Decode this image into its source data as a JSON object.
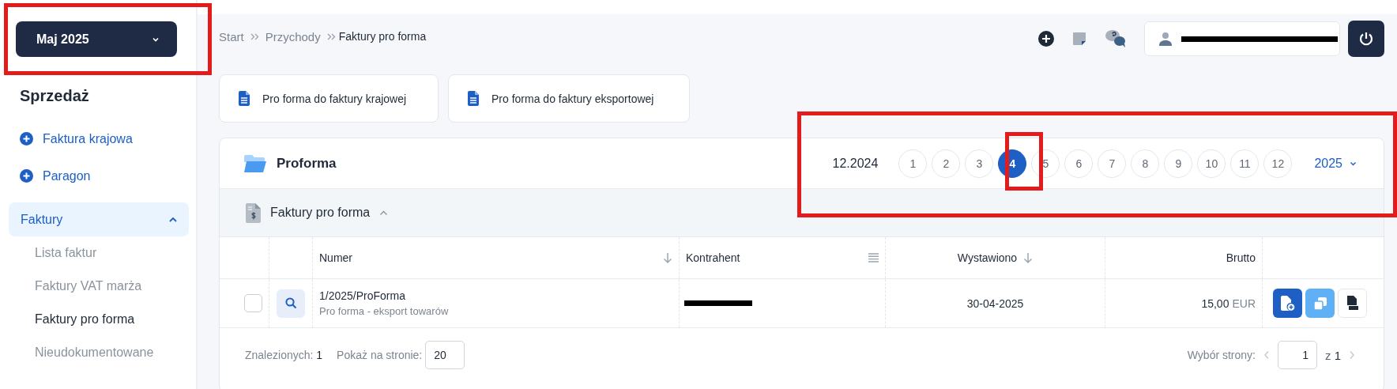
{
  "period_button": {
    "label": "Maj 2025"
  },
  "sidebar": {
    "heading": "Sprzedaż",
    "actions": [
      {
        "label": "Faktura krajowa"
      },
      {
        "label": "Paragon"
      }
    ],
    "groups": [
      {
        "label": "Faktury",
        "expanded": true,
        "children": [
          {
            "label": "Lista faktur",
            "selected": false
          },
          {
            "label": "Faktury VAT marża",
            "selected": false
          },
          {
            "label": "Faktury pro forma",
            "selected": true
          },
          {
            "label": "Nieudokumentowane",
            "selected": false
          }
        ]
      }
    ]
  },
  "breadcrumb": [
    {
      "label": "Start",
      "current": false
    },
    {
      "label": "Przychody",
      "current": false
    },
    {
      "label": "Faktury pro forma",
      "current": true
    }
  ],
  "create_buttons": [
    {
      "label": "Pro forma do faktury krajowej"
    },
    {
      "label": "Pro forma do faktury eksportowej"
    }
  ],
  "card": {
    "title": "Proforma",
    "previous_period": "12.2024",
    "months": [
      {
        "label": "1",
        "selected": false
      },
      {
        "label": "2",
        "selected": false
      },
      {
        "label": "3",
        "selected": false
      },
      {
        "label": "4",
        "selected": true
      },
      {
        "label": "5",
        "selected": false
      },
      {
        "label": "6",
        "selected": false
      },
      {
        "label": "7",
        "selected": false
      },
      {
        "label": "8",
        "selected": false
      },
      {
        "label": "9",
        "selected": false
      },
      {
        "label": "10",
        "selected": false
      },
      {
        "label": "11",
        "selected": false
      },
      {
        "label": "12",
        "selected": false
      }
    ],
    "year": "2025",
    "section_title": "Faktury pro forma",
    "section_expanded": true
  },
  "table": {
    "columns": [
      {
        "label": "Numer",
        "kind": "sortable"
      },
      {
        "label": "Kontrahent",
        "kind": "filterable"
      },
      {
        "label": "Wystawiono",
        "kind": "sortable"
      },
      {
        "label": "Brutto",
        "kind": "plain"
      }
    ],
    "rows": [
      {
        "checked": false,
        "number": "1/2025/ProForma",
        "description": "Pro forma - eksport towarów",
        "date": "30-04-2025",
        "amount": "15,00",
        "currency": "EUR"
      }
    ]
  },
  "footer": {
    "found_label": "Znalezionych:",
    "found_count": "1",
    "per_page_label": "Pokaż na stronie:",
    "per_page": "20",
    "page_label": "Wybór strony:",
    "page": "1",
    "of_label": "z",
    "page_count": "1"
  }
}
